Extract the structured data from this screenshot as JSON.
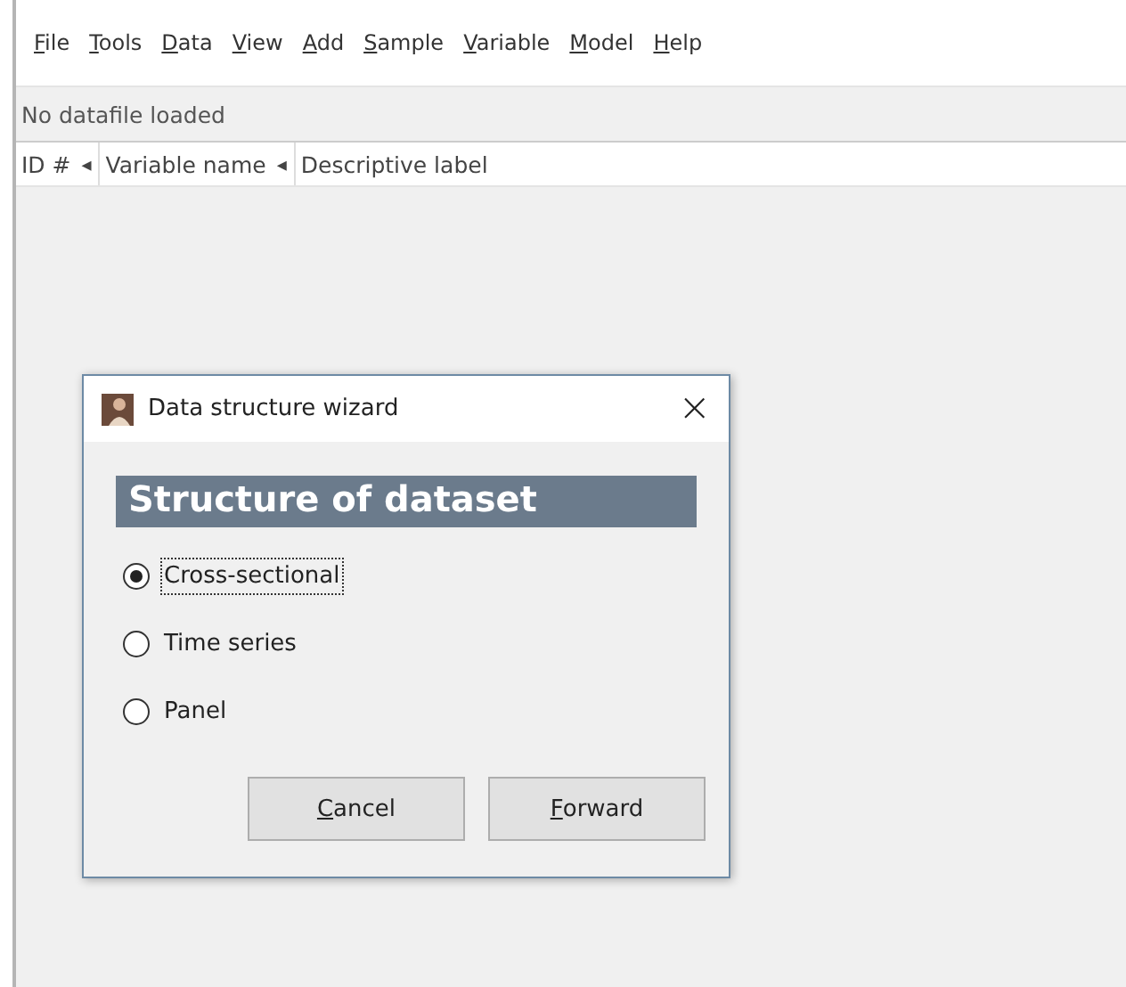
{
  "menu": [
    {
      "label": "File",
      "mnemonic": true
    },
    {
      "label": "Tools",
      "mnemonic": true
    },
    {
      "label": "Data",
      "mnemonic": true
    },
    {
      "label": "View",
      "mnemonic": true
    },
    {
      "label": "Add",
      "mnemonic": true
    },
    {
      "label": "Sample",
      "mnemonic": true
    },
    {
      "label": "Variable",
      "mnemonic": true
    },
    {
      "label": "Model",
      "mnemonic": true
    },
    {
      "label": "Help",
      "mnemonic": true
    }
  ],
  "status": "No datafile loaded",
  "table": {
    "columns": [
      {
        "label": "ID #",
        "sort_arrow": "◂"
      },
      {
        "label": "Variable name",
        "sort_arrow": "◂"
      },
      {
        "label": "Descriptive label"
      }
    ]
  },
  "dialog": {
    "title": "Data structure wizard",
    "close": "×",
    "heading": "Structure of dataset",
    "options": [
      {
        "label": "Cross-sectional",
        "selected": true
      },
      {
        "label": "Time series",
        "selected": false
      },
      {
        "label": "Panel",
        "selected": false
      }
    ],
    "buttons": [
      {
        "label": "Cancel",
        "mnemonic": true
      },
      {
        "label": "Forward",
        "mnemonic": true
      }
    ]
  }
}
